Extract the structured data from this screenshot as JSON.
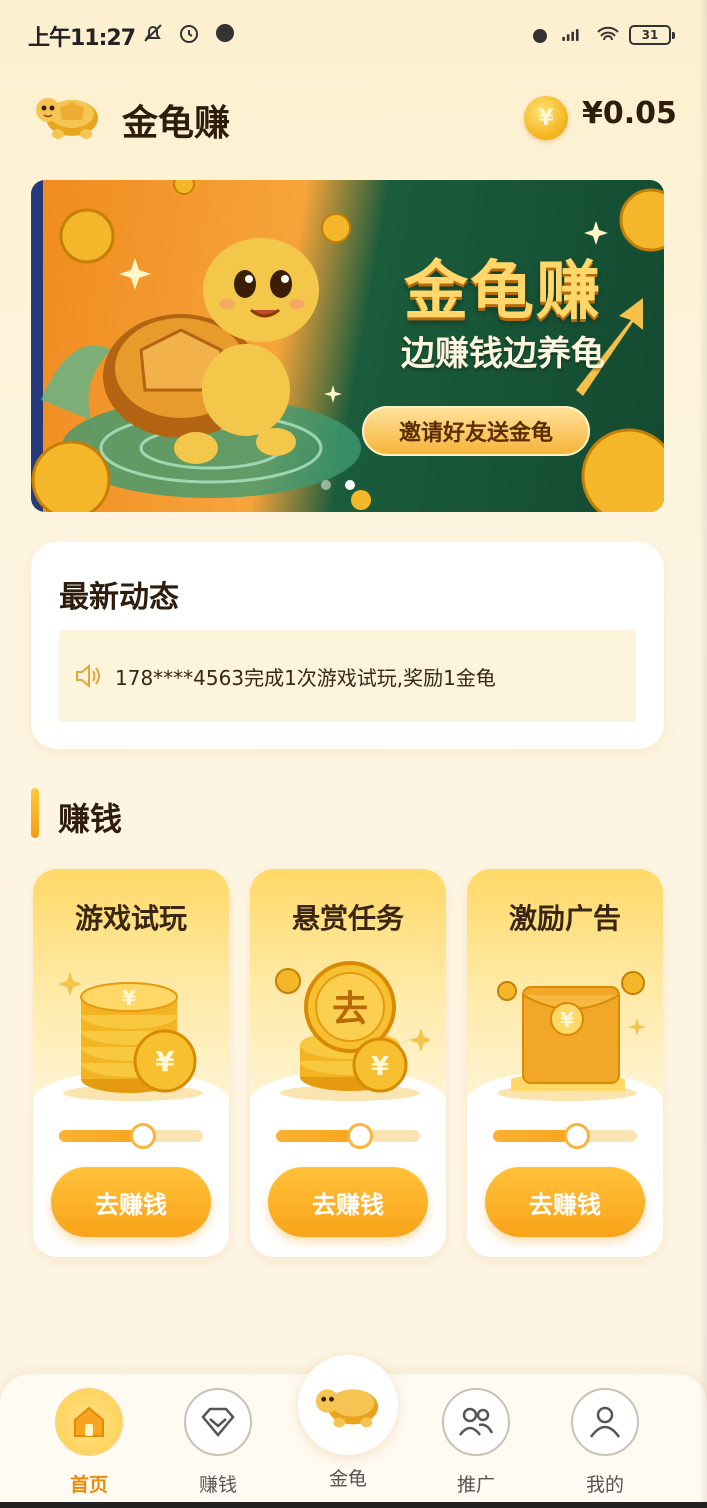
{
  "status_bar": {
    "time": "上午11:27",
    "battery": "31"
  },
  "header": {
    "title": "金龟赚",
    "coin_symbol": "¥",
    "balance": "¥0.05"
  },
  "banner": {
    "title": "金龟赚",
    "subtitle": "边赚钱边养龟",
    "button": "邀请好友送金龟",
    "slides": 2,
    "active_slide": 2
  },
  "news": {
    "title": "最新动态",
    "message": "178****4563完成1次游戏试玩,奖励1金龟"
  },
  "earn_section": {
    "title": "赚钱",
    "cards": [
      {
        "title": "游戏试玩",
        "button": "去赚钱",
        "progress": 0.58,
        "coin_glyph": "¥"
      },
      {
        "title": "悬赏任务",
        "button": "去赚钱",
        "progress": 0.58,
        "coin_glyph": "去"
      },
      {
        "title": "激励广告",
        "button": "去赚钱",
        "progress": 0.58,
        "coin_glyph": "¥"
      }
    ]
  },
  "bottom_nav": {
    "items": [
      {
        "label": "首页",
        "icon": "home-icon",
        "active": true
      },
      {
        "label": "赚钱",
        "icon": "diamond-icon",
        "active": false
      },
      {
        "label": "金龟",
        "icon": "turtle-icon",
        "active": false
      },
      {
        "label": "推广",
        "icon": "users-icon",
        "active": false
      },
      {
        "label": "我的",
        "icon": "user-icon",
        "active": false
      }
    ]
  },
  "colors": {
    "accent": "#f9a319",
    "active_nav": "#ea8c0a",
    "background": "#fdf4e4"
  }
}
